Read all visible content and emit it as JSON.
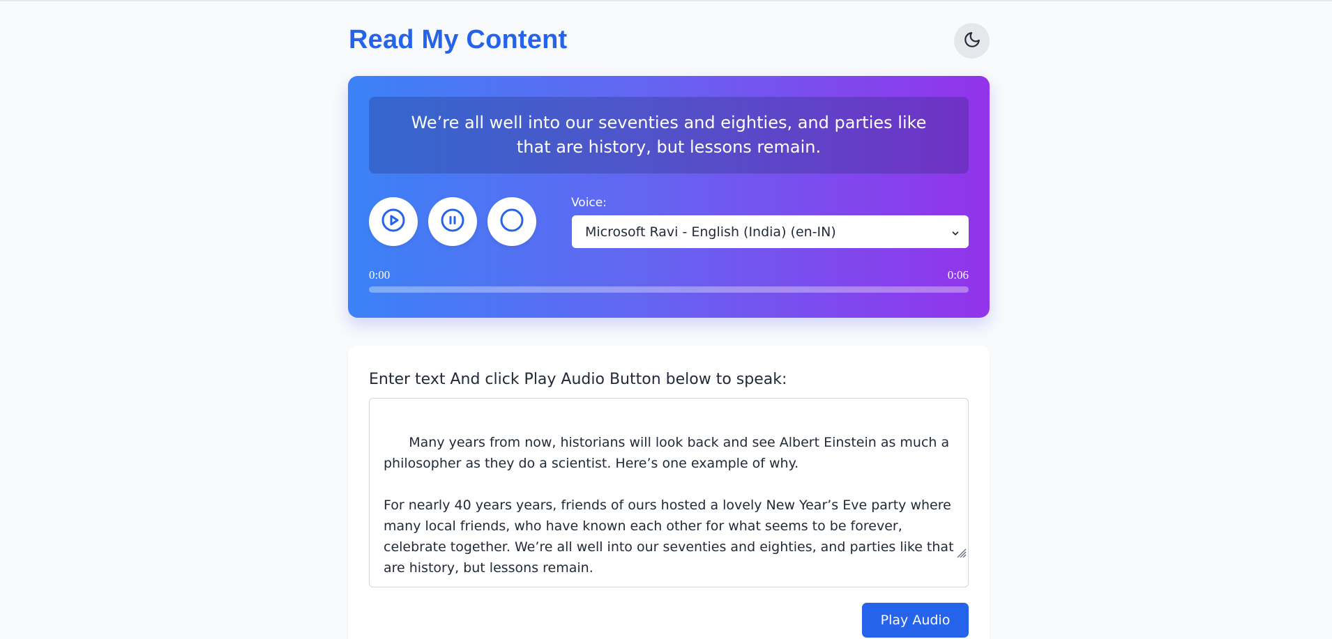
{
  "app": {
    "title": "Read My Content"
  },
  "header": {
    "theme_toggle_icon": "moon-icon"
  },
  "player": {
    "caption": "We’re all well into our seventies and eighties, and parties like that are history, but lessons remain.",
    "controls": {
      "play_icon": "play-circle-icon",
      "pause_icon": "pause-circle-icon",
      "stop_icon": "stop-circle-icon"
    },
    "voice_label": "Voice:",
    "voice_selected": "Microsoft Ravi - English (India) (en-IN)",
    "time_current": "0:00",
    "time_total": "0:06",
    "progress": 0,
    "gradient_colors": [
      "#3b82f6",
      "#6366f1",
      "#9333ea"
    ]
  },
  "input": {
    "label": "Enter text And click Play Audio Button below to speak:",
    "text": "Many years from now, historians will look back and see Albert Einstein as much a philosopher as they do a scientist. Here’s one example of why.\n\nFor nearly 40 years years, friends of ours hosted a lovely New Year’s Eve party where many local friends, who have known each other for what seems to be forever, celebrate together. We’re all well into our seventies and eighties, and parties like that are history, but lessons remain.",
    "play_button_label": "Play Audio"
  },
  "colors": {
    "accent": "#2563eb",
    "background": "#f8fafc"
  }
}
